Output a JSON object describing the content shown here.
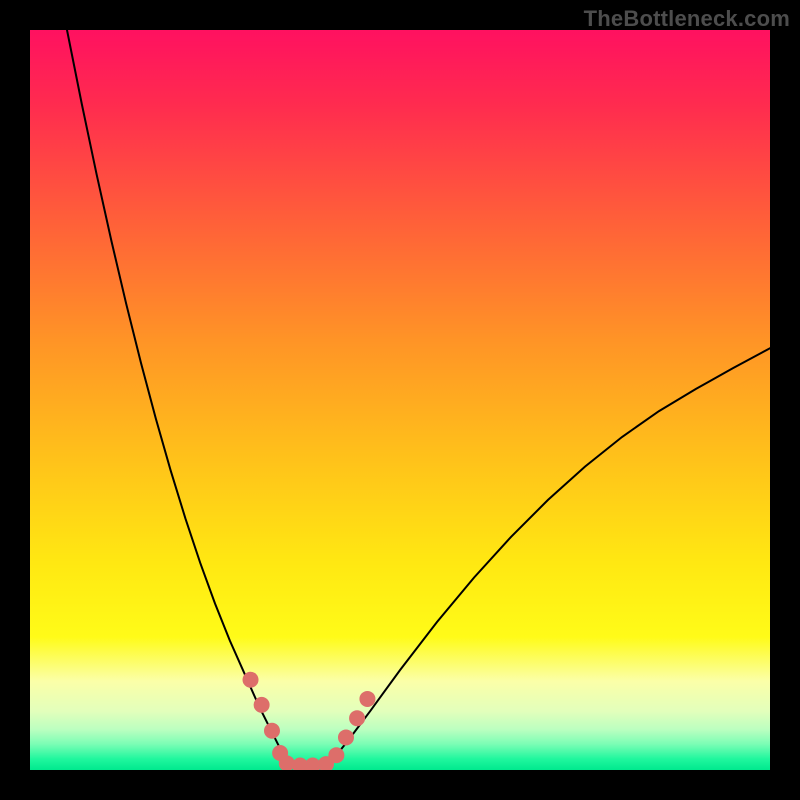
{
  "watermark": "TheBottleneck.com",
  "chart_data": {
    "type": "line",
    "title": "",
    "xlabel": "",
    "ylabel": "",
    "xlim": [
      0,
      100
    ],
    "ylim": [
      0,
      100
    ],
    "grid": false,
    "legend": false,
    "background_gradient": {
      "stops": [
        {
          "pos": 0.0,
          "color": "#ff1160"
        },
        {
          "pos": 0.1,
          "color": "#ff2b4f"
        },
        {
          "pos": 0.25,
          "color": "#ff5d3a"
        },
        {
          "pos": 0.42,
          "color": "#ff9426"
        },
        {
          "pos": 0.58,
          "color": "#ffc21a"
        },
        {
          "pos": 0.72,
          "color": "#ffe812"
        },
        {
          "pos": 0.82,
          "color": "#fffb18"
        },
        {
          "pos": 0.88,
          "color": "#fbffa8"
        },
        {
          "pos": 0.92,
          "color": "#e3ffbb"
        },
        {
          "pos": 0.945,
          "color": "#bcffc0"
        },
        {
          "pos": 0.965,
          "color": "#7bfdb5"
        },
        {
          "pos": 0.985,
          "color": "#20f79e"
        },
        {
          "pos": 1.0,
          "color": "#00e98e"
        }
      ]
    },
    "series": [
      {
        "name": "left-branch",
        "stroke": "#000000",
        "stroke_width": 2,
        "x": [
          5,
          7,
          9,
          11,
          13,
          15,
          17,
          19,
          21,
          23,
          25,
          27,
          29,
          31,
          33,
          34.5
        ],
        "y": [
          100,
          90,
          80.5,
          71.5,
          63,
          55,
          47.5,
          40.5,
          34,
          28,
          22.5,
          17.5,
          13,
          8.5,
          4.5,
          1.5
        ]
      },
      {
        "name": "right-branch",
        "stroke": "#000000",
        "stroke_width": 2,
        "x": [
          41,
          43,
          46,
          50,
          55,
          60,
          65,
          70,
          75,
          80,
          85,
          90,
          95,
          100
        ],
        "y": [
          1.5,
          4,
          8,
          13.5,
          20,
          26,
          31.5,
          36.5,
          41,
          45,
          48.5,
          51.5,
          54.3,
          57
        ]
      },
      {
        "name": "marker-dots",
        "type": "scatter",
        "fill": "#dd6e6a",
        "radius": 8,
        "points": [
          {
            "x": 29.8,
            "y": 12.2
          },
          {
            "x": 31.3,
            "y": 8.8
          },
          {
            "x": 32.7,
            "y": 5.3
          },
          {
            "x": 33.8,
            "y": 2.3
          },
          {
            "x": 34.7,
            "y": 0.9
          },
          {
            "x": 36.5,
            "y": 0.6
          },
          {
            "x": 38.2,
            "y": 0.6
          },
          {
            "x": 40.0,
            "y": 0.8
          },
          {
            "x": 41.4,
            "y": 2.0
          },
          {
            "x": 42.7,
            "y": 4.4
          },
          {
            "x": 44.2,
            "y": 7.0
          },
          {
            "x": 45.6,
            "y": 9.6
          }
        ]
      }
    ]
  }
}
